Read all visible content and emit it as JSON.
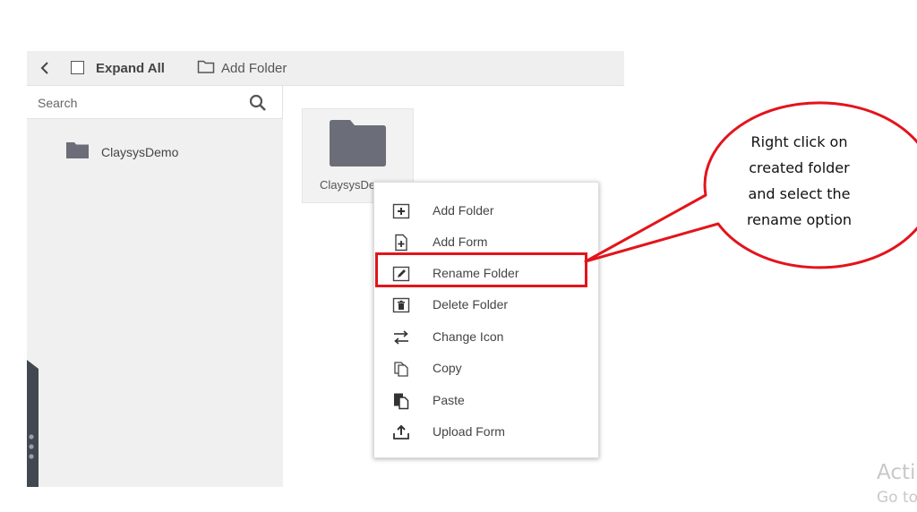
{
  "toolbar": {
    "expand_all_label": "Expand All",
    "add_folder_label": "Add Folder"
  },
  "sidebar": {
    "search_placeholder": "Search",
    "tree": [
      {
        "label": "ClaysysDemo",
        "icon": "folder-icon"
      }
    ]
  },
  "content": {
    "tiles": [
      {
        "label": "ClaysysDemo",
        "visible_label": "ClaysysDe",
        "icon": "folder-icon"
      }
    ]
  },
  "context_menu": {
    "items": [
      {
        "label": "Add Folder",
        "icon": "add-folder-icon"
      },
      {
        "label": "Add Form",
        "icon": "add-form-icon"
      },
      {
        "label": "Rename Folder",
        "icon": "rename-icon",
        "highlighted": true
      },
      {
        "label": "Delete Folder",
        "icon": "trash-icon"
      },
      {
        "label": "Change Icon",
        "icon": "swap-arrows-icon"
      },
      {
        "label": "Copy",
        "icon": "copy-icon"
      },
      {
        "label": "Paste",
        "icon": "paste-icon"
      },
      {
        "label": "Upload Form",
        "icon": "upload-icon"
      }
    ]
  },
  "callout": {
    "lines": [
      "Right click on",
      "created folder",
      "and select the",
      "rename option"
    ]
  },
  "watermark": {
    "line1": "Acti",
    "line2": "Go to"
  },
  "colors": {
    "highlight": "#e3141b",
    "folder": "#6b6e78",
    "toolbar_bg": "#efefef",
    "sidebar_bg": "#f0f0f0",
    "rail": "#424751"
  }
}
